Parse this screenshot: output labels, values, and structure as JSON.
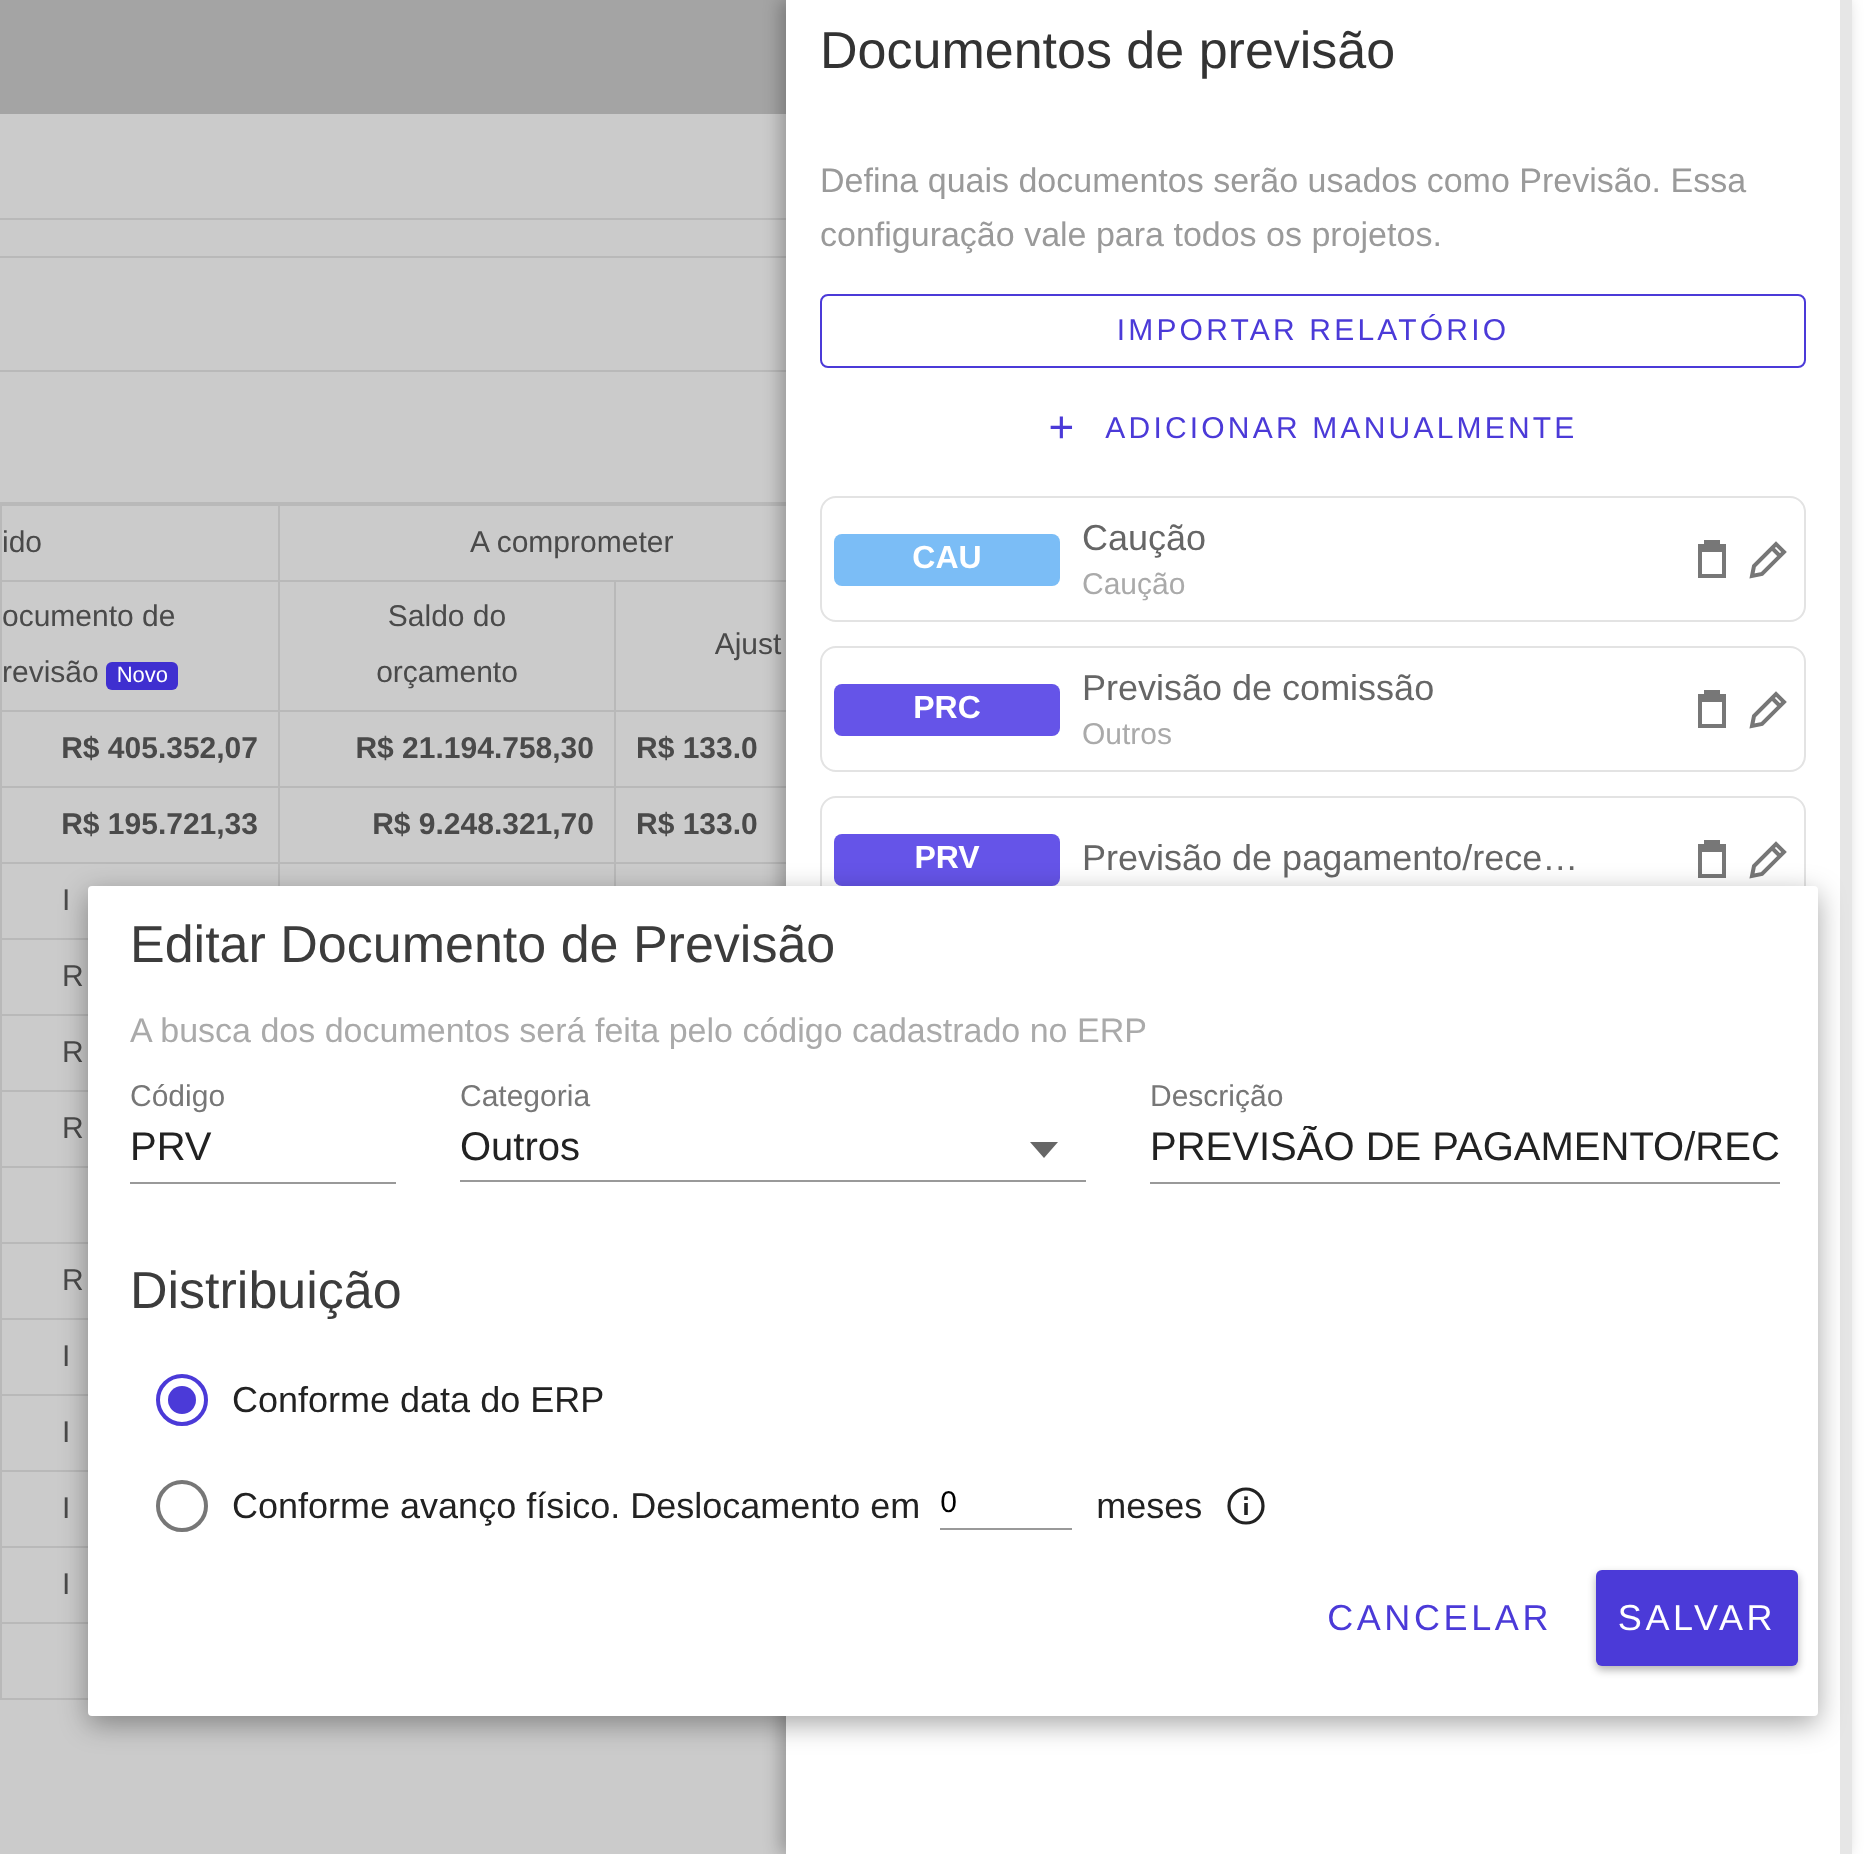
{
  "table": {
    "group_headers": [
      "ido",
      "A comprometer"
    ],
    "columns": [
      {
        "lines": [
          "ocumento de",
          "revisão"
        ],
        "badge": "Novo"
      },
      {
        "lines": [
          "Saldo do",
          "orçamento"
        ]
      },
      {
        "lines": [
          "Ajust"
        ]
      }
    ],
    "rows": [
      [
        "R$ 405.352,07",
        "R$ 21.194.758,30",
        "R$ 133.0"
      ],
      [
        "R$ 195.721,33",
        "R$ 9.248.321,70",
        "R$ 133.0"
      ]
    ],
    "covered_rows": [
      "I",
      "R",
      "R",
      "R",
      "",
      "R",
      "I",
      "I",
      "I",
      "I",
      ""
    ]
  },
  "drawer": {
    "title": "Documentos de previsão",
    "description": "Defina quais documentos serão usados como Previsão. Essa configuração vale para todos os projetos.",
    "import_button": "IMPORTAR RELATÓRIO",
    "add_button": {
      "icon": "+",
      "label": "ADICIONAR MANUALMENTE"
    },
    "documents": [
      {
        "code": "CAU",
        "color": "#7bbdf6",
        "name": "Caução",
        "category": "Caução"
      },
      {
        "code": "PRC",
        "color": "#6554e8",
        "name": "Previsão de comissão",
        "category": "Outros"
      },
      {
        "code": "PRV",
        "color": "#6554e8",
        "name": "Previsão de pagamento/rece…"
      }
    ]
  },
  "dialog": {
    "title": "Editar Documento de Previsão",
    "hint": "A busca dos documentos será feita pelo código cadastrado no ERP",
    "fields": [
      {
        "kind": "text",
        "label": "Código",
        "value": "PRV"
      },
      {
        "kind": "select",
        "label": "Categoria",
        "value": "Outros"
      },
      {
        "kind": "text",
        "label": "Descrição",
        "value": "PREVISÃO DE PAGAMENTO/REC"
      }
    ],
    "section_title": "Distribuição",
    "options": [
      {
        "kind": "plain",
        "label": "Conforme data do ERP",
        "selected": true
      },
      {
        "kind": "offset",
        "label": "Conforme avanço físico. Deslocamento em",
        "value": "0",
        "suffix": "meses",
        "selected": false
      }
    ],
    "cancel_button": "CANCELAR",
    "save_button": "SALVAR"
  }
}
